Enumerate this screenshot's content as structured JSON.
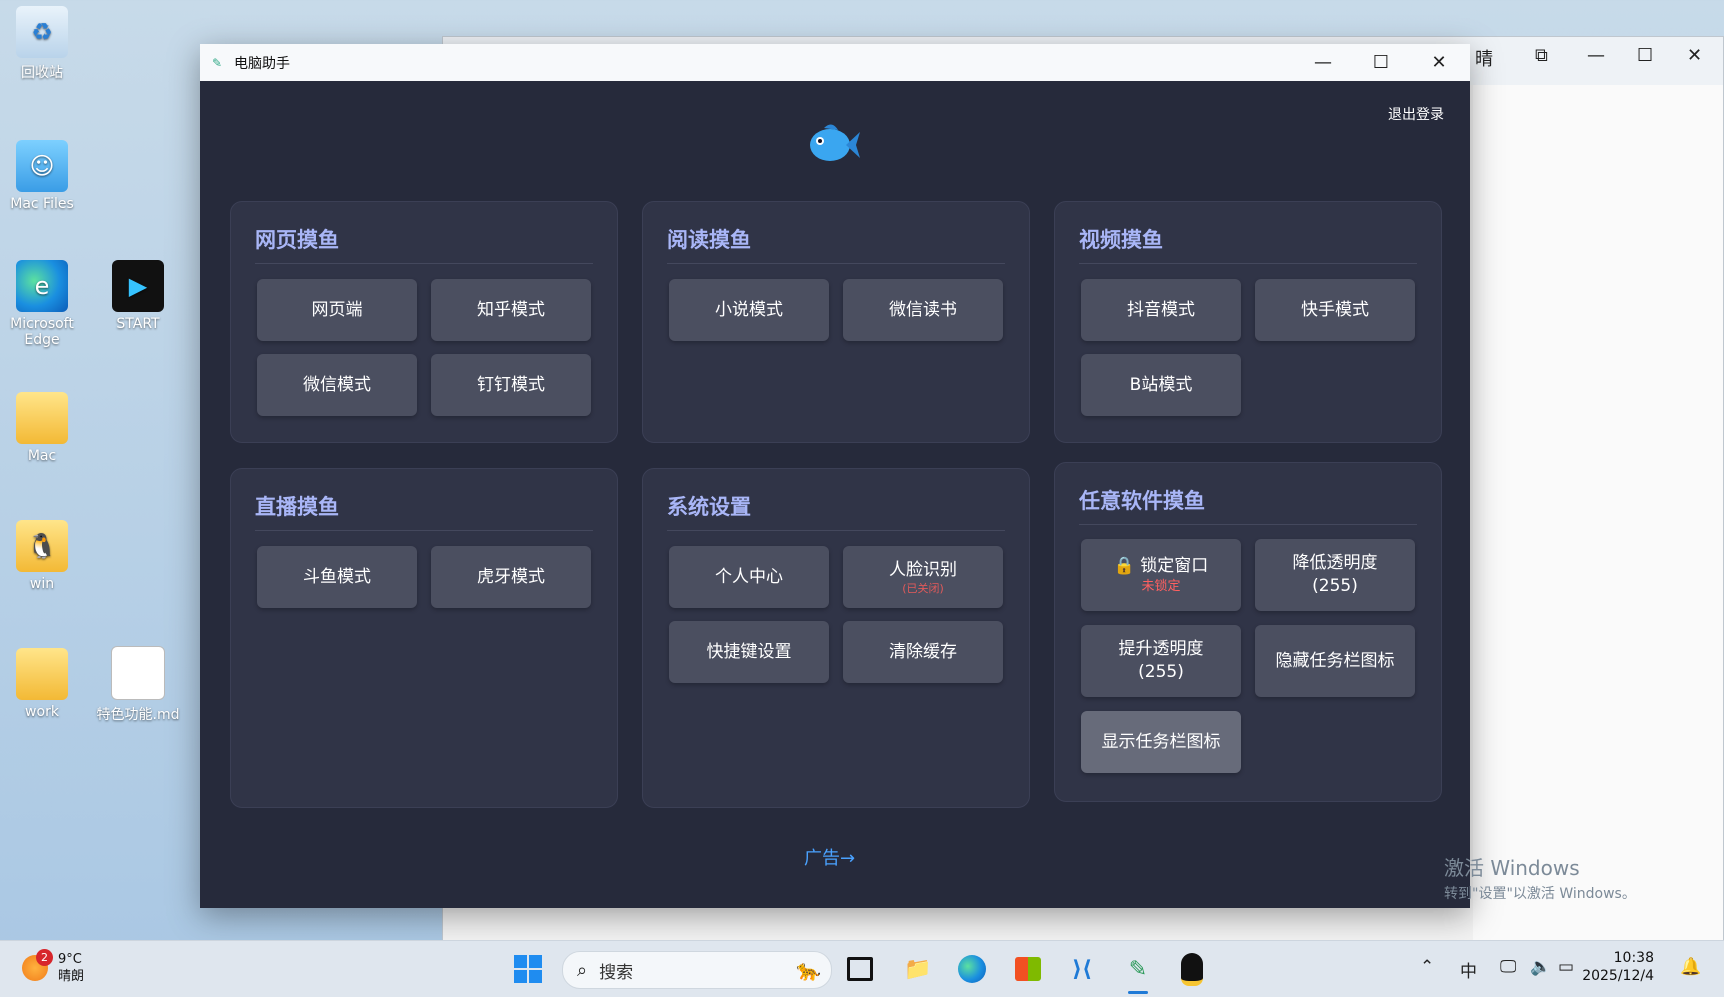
{
  "desktop": {
    "icons": [
      {
        "label": "回收站",
        "icon": "recycle-bin-icon"
      },
      {
        "label": "Mac Files",
        "icon": "folder-icon"
      },
      {
        "label": "Microsoft Edge",
        "icon": "edge-icon"
      },
      {
        "label": "START",
        "icon": "start-app-icon"
      },
      {
        "label": "Mac",
        "icon": "folder-icon"
      },
      {
        "label": "win",
        "icon": "folder-icon"
      },
      {
        "label": "work",
        "icon": "folder-icon"
      },
      {
        "label": "特色功能.md",
        "icon": "document-icon"
      }
    ],
    "background_window_partial_title": "晴",
    "activation_watermark": {
      "line1": "激活 Windows",
      "line2": "转到\"设置\"以激活 Windows。"
    }
  },
  "app": {
    "title": "电脑助手",
    "logout_label": "退出登录",
    "ad_link": "广告→",
    "sections": {
      "web": {
        "title": "网页摸鱼",
        "buttons": [
          "网页端",
          "知乎模式",
          "微信模式",
          "钉钉模式"
        ]
      },
      "reading": {
        "title": "阅读摸鱼",
        "buttons": [
          "小说模式",
          "微信读书"
        ]
      },
      "video": {
        "title": "视频摸鱼",
        "buttons": [
          "抖音模式",
          "快手模式",
          "B站模式"
        ]
      },
      "live": {
        "title": "直播摸鱼",
        "buttons": [
          "斗鱼模式",
          "虎牙模式"
        ]
      },
      "settings": {
        "title": "系统设置",
        "buttons": [
          "个人中心",
          "人脸识别",
          "快捷键设置",
          "清除缓存"
        ],
        "face_status": "(已关闭)"
      },
      "any_software": {
        "title": "任意软件摸鱼",
        "lock_label": "🔒 锁定窗口",
        "lock_status": "未锁定",
        "lower_label": "降低透明度",
        "lower_value": "(255)",
        "raise_label": "提升透明度",
        "raise_value": "(255)",
        "hide_label": "隐藏任务栏图标",
        "show_label": "显示任务栏图标"
      }
    },
    "accent_color": "#a9b6f7",
    "ad_color": "#4aa2ff"
  },
  "taskbar": {
    "weather": {
      "temp": "9°C",
      "desc": "晴朗",
      "badge": "2"
    },
    "search_placeholder": "搜索",
    "tray": {
      "ime": "中"
    },
    "clock": {
      "time": "10:38",
      "date": "2025/12/4"
    }
  }
}
